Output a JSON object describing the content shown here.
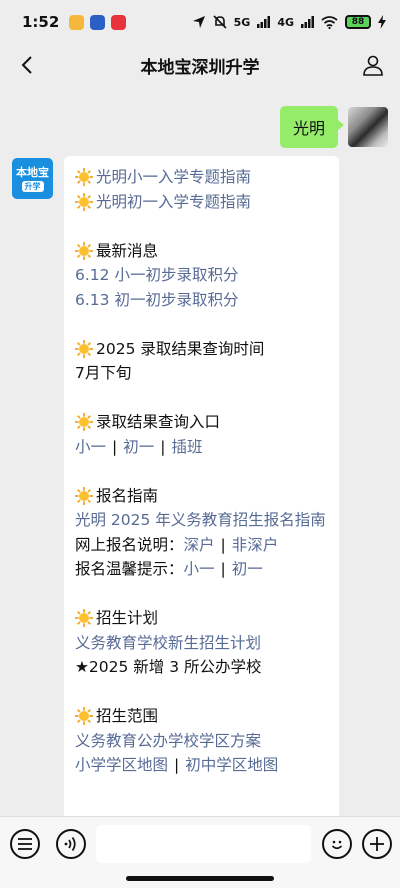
{
  "status_bar": {
    "time": "1:52",
    "network_5g": "5G",
    "network_4g": "4G",
    "battery": "88"
  },
  "nav": {
    "title": "本地宝深圳升学"
  },
  "chat": {
    "user_message": "光明",
    "bot_avatar": {
      "line1": "本地宝",
      "line2": "升学"
    },
    "bot": {
      "guide_1": "光明小一入学专题指南",
      "guide_2": "光明初一入学专题指南",
      "news_title": "最新消息",
      "news_1": "6.12 小一初步录取积分",
      "news_2": "6.13 初一初步录取积分",
      "result_time_title": "2025 录取结果查询时间",
      "result_time_value": "7月下旬",
      "result_entry_title": "录取结果查询入口",
      "result_entry_links": [
        "小一",
        "初一",
        "插班"
      ],
      "signup_title": "报名指南",
      "signup_link": "光明 2025 年义务教育招生报名指南",
      "online_label": "网上报名说明：",
      "online_links": [
        "深户",
        "非深户"
      ],
      "tips_label": "报名温馨提示：",
      "tips_links": [
        "小一",
        "初一"
      ],
      "plan_title": "招生计划",
      "plan_link": "义务教育学校新生招生计划",
      "plan_note": "★2025 新增 3 所公办学校",
      "range_title": "招生范围",
      "range_link": "义务教育公办学校学区方案",
      "map_links": [
        "小学学区地图",
        "初中学区地图"
      ]
    }
  },
  "input_bar": {
    "placeholder": ""
  },
  "colors": {
    "user_bubble": "#95ec69",
    "link": "#576b95",
    "background": "#ededed"
  },
  "icons": [
    "back-arrow-icon",
    "profile-icon",
    "voice-icon",
    "keyboard-menu-icon",
    "emoji-icon",
    "plus-icon",
    "sun-emoji-icon"
  ]
}
